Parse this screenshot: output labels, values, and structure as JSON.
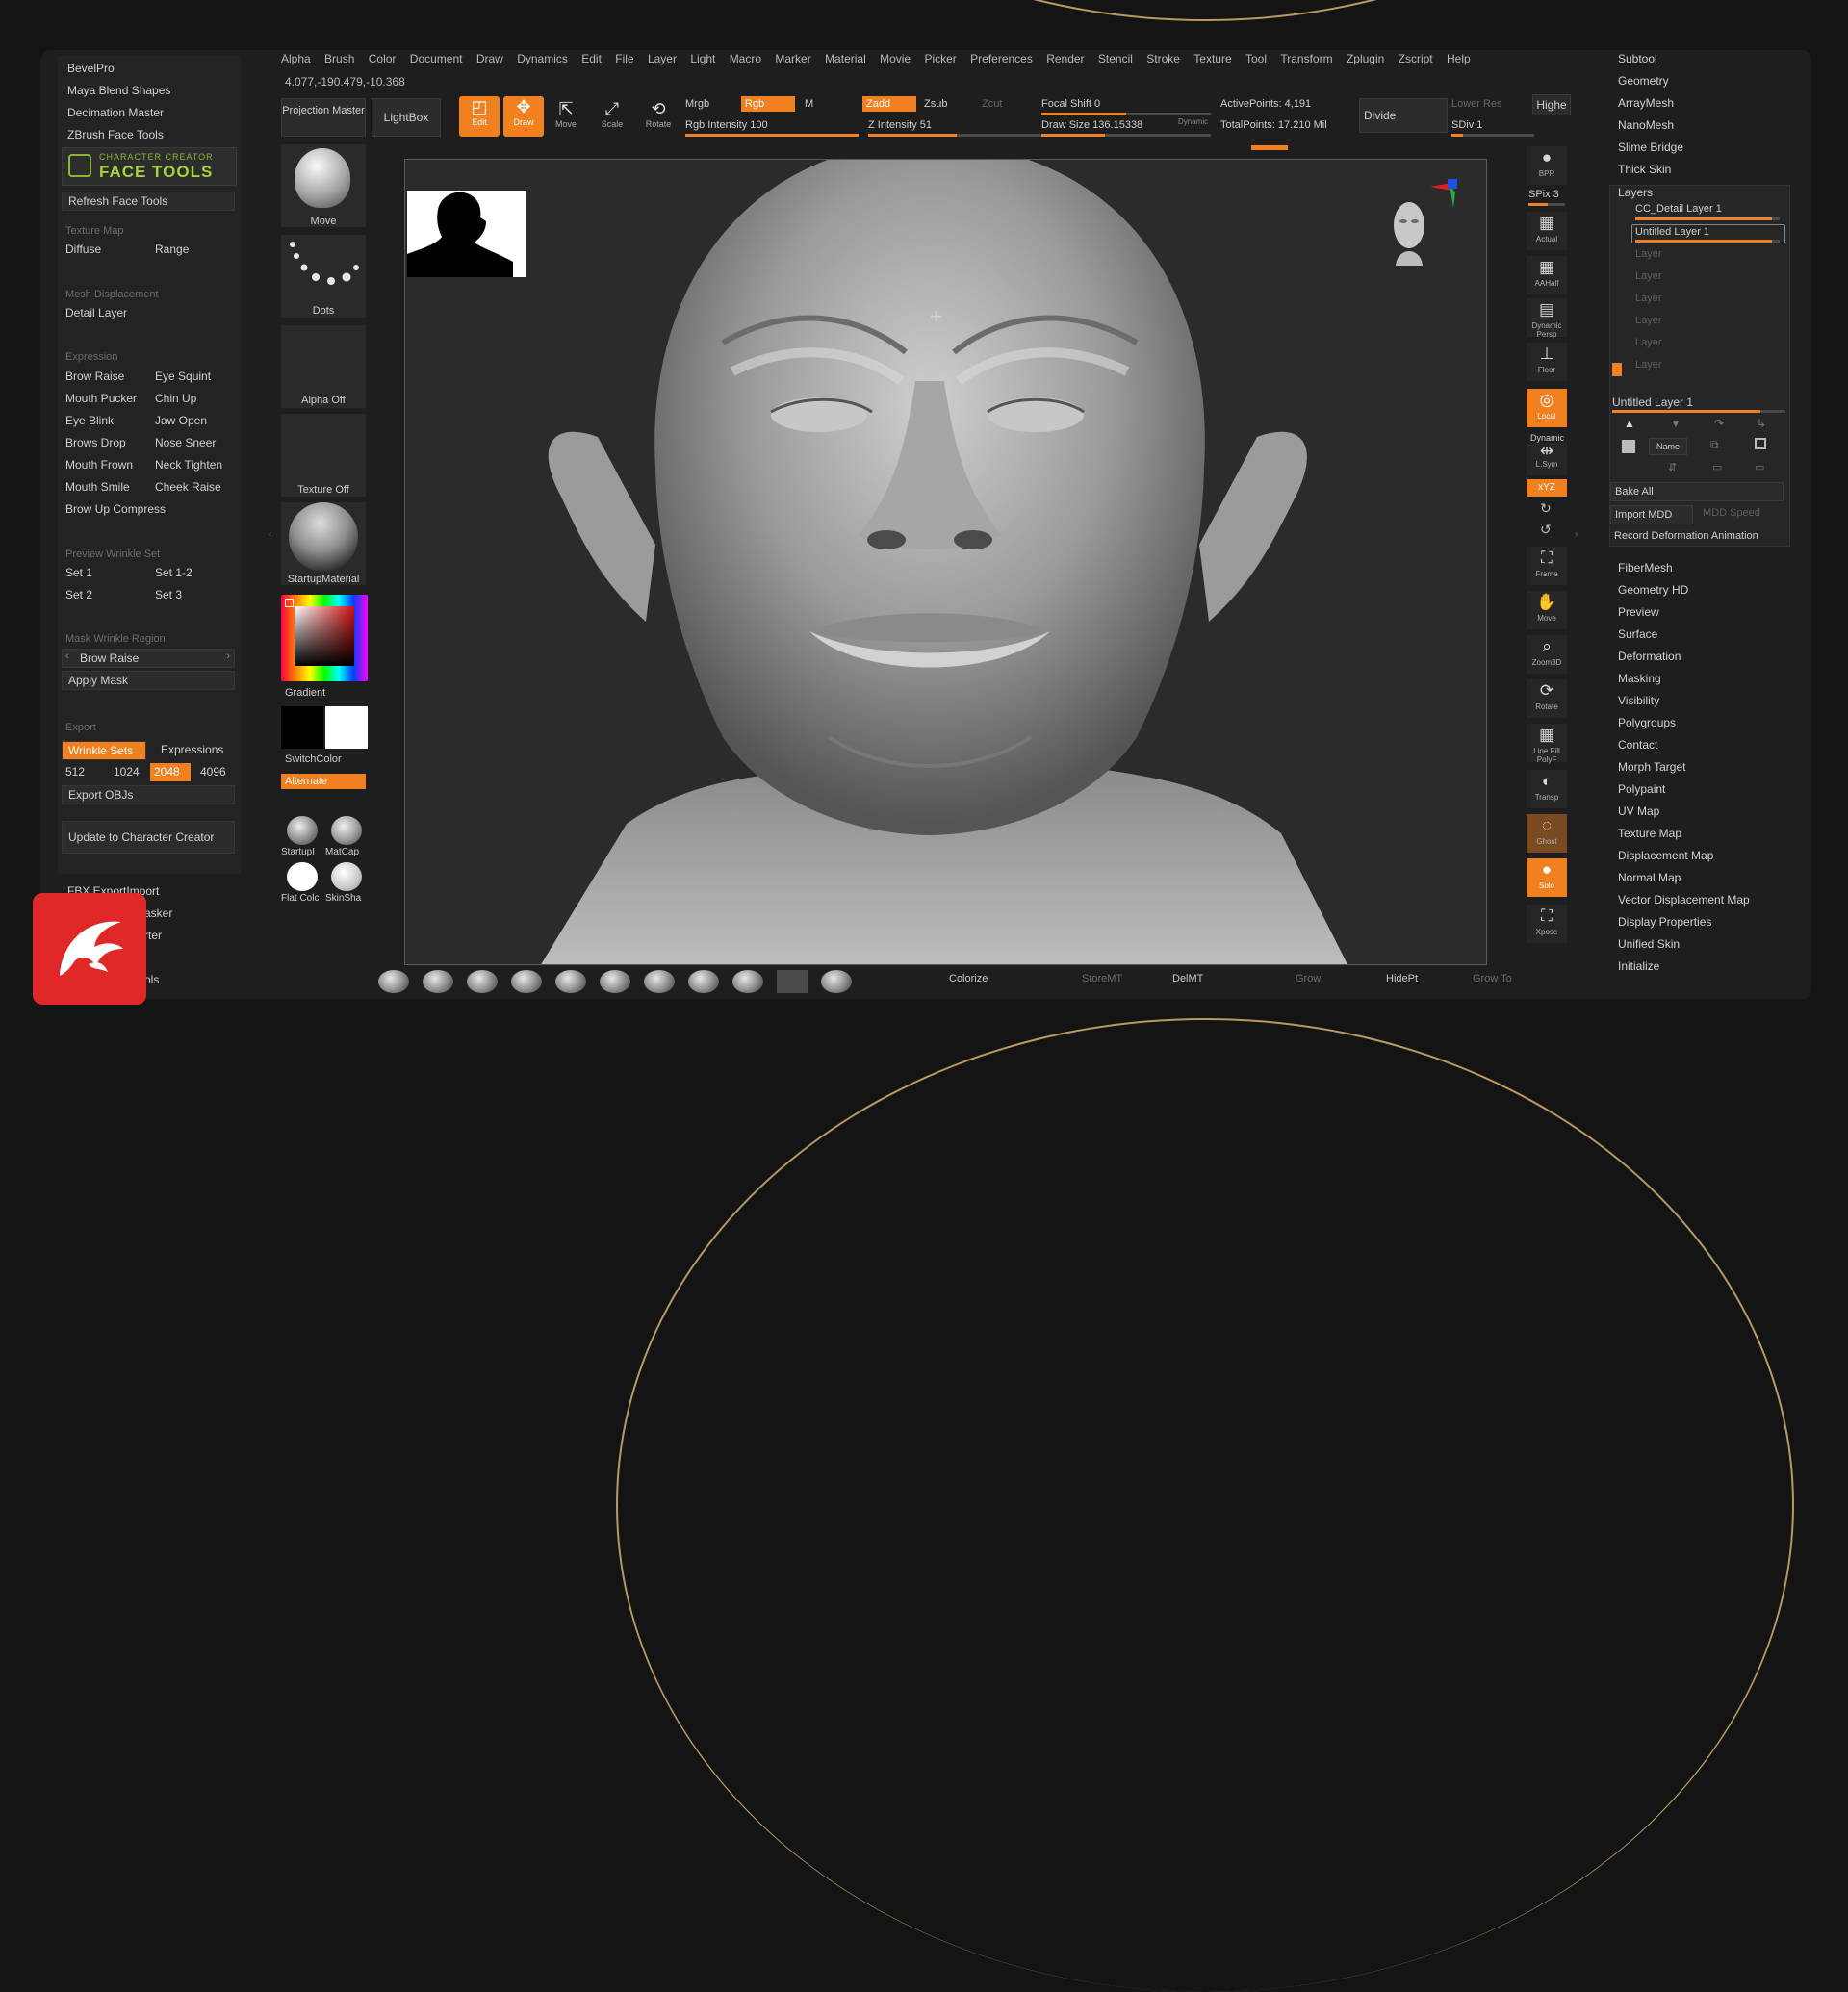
{
  "left_panel": {
    "plugins": [
      "BevelPro",
      "Maya Blend Shapes",
      "Decimation Master",
      "ZBrush Face Tools"
    ],
    "logo_line1": "CHARACTER CREATOR",
    "logo_line2": "FACE TOOLS",
    "refresh": "Refresh Face Tools",
    "texture_map_head": "Texture Map",
    "diffuse": "Diffuse",
    "range": "Range",
    "mesh_disp_head": "Mesh Displacement",
    "detail_layer": "Detail Layer",
    "expression_head": "Expression",
    "expressions": [
      [
        "Brow Raise",
        "Eye Squint"
      ],
      [
        "Mouth Pucker",
        "Chin Up"
      ],
      [
        "Eye Blink",
        "Jaw Open"
      ],
      [
        "Brows Drop",
        "Nose Sneer"
      ],
      [
        "Mouth Frown",
        "Neck Tighten"
      ],
      [
        "Mouth Smile",
        "Cheek Raise"
      ]
    ],
    "brow_up_compress": "Brow Up Compress",
    "preview_head": "Preview Wrinkle Set",
    "sets": [
      [
        "Set 1",
        "Set 1-2"
      ],
      [
        "Set 2",
        "Set 3"
      ]
    ],
    "mask_head": "Mask Wrinkle Region",
    "mask_select": "Brow Raise",
    "apply_mask": "Apply Mask",
    "export_head": "Export",
    "wrinkle_sets": "Wrinkle Sets",
    "expressions_btn": "Expressions",
    "sizes": [
      "512",
      "1024",
      "2048",
      "4096"
    ],
    "export_objs": "Export OBJs",
    "update_cc": "Update to Character Creator",
    "fbx": "FBX ExportImport",
    "partial": [
      "asker",
      "rter",
      "ols"
    ]
  },
  "menu": [
    "Alpha",
    "Brush",
    "Color",
    "Document",
    "Draw",
    "Dynamics",
    "Edit",
    "File",
    "Layer",
    "Light",
    "Macro",
    "Marker",
    "Material",
    "Movie",
    "Picker",
    "Preferences",
    "Render",
    "Stencil",
    "Stroke",
    "Texture",
    "Tool",
    "Transform",
    "Zplugin",
    "Zscript",
    "Help"
  ],
  "coords": "4.077,-190.479,-10.368",
  "toolbar": {
    "projection_master": "Projection Master",
    "lightbox": "LightBox",
    "edit": "Edit",
    "draw": "Draw",
    "move": "Move",
    "scale": "Scale",
    "rotate": "Rotate",
    "mrgb": "Mrgb",
    "rgb": "Rgb",
    "m": "M",
    "rgb_intensity": "Rgb Intensity 100",
    "zadd": "Zadd",
    "zsub": "Zsub",
    "zcut": "Zcut",
    "z_intensity": "Z Intensity 51",
    "focal_shift": "Focal Shift 0",
    "draw_size": "Draw Size 136.15338",
    "dynamic": "Dynamic",
    "active_points": "ActivePoints: 4,191",
    "total_points": "TotalPoints: 17.210 Mil",
    "divide": "Divide",
    "lower_res": "Lower Res",
    "higher_res": "Highe",
    "sdiv": "SDiv 1"
  },
  "brush_column": {
    "move": "Move",
    "dots": "Dots",
    "alpha_off": "Alpha Off",
    "texture_off": "Texture Off",
    "startup_material": "StartupMaterial",
    "gradient": "Gradient",
    "switch_color": "SwitchColor",
    "alternate": "Alternate",
    "mat1": "StartupI",
    "mat2": "MatCap",
    "mat3": "Flat Colc",
    "mat4": "SkinSha"
  },
  "right_shelf": {
    "bpr": "BPR",
    "spix": "SPix 3",
    "actual": "Actual",
    "aahalf": "AAHalf",
    "dynamic_persp": "Dynamic Persp",
    "floor": "Floor",
    "local": "Local",
    "dynamic": "Dynamic",
    "lsym": "L.Sym",
    "xyz": "xYZ",
    "frame": "Frame",
    "move": "Move",
    "zoom3d": "Zoom3D",
    "rotate": "Rotate",
    "linefill": "Line Fill PolyF",
    "transp": "Transp",
    "ghost": "Ghost",
    "solo": "Solo",
    "xpose": "Xpose"
  },
  "right_panel": {
    "top_items": [
      "Subtool",
      "Geometry",
      "ArrayMesh",
      "NanoMesh",
      "Slime Bridge",
      "Thick Skin"
    ],
    "layers": "Layers",
    "layer_list": [
      "CC_Detail Layer 1",
      "Untitled Layer 1",
      "Layer",
      "Layer",
      "Layer",
      "Layer",
      "Layer",
      "Layer"
    ],
    "current_layer": "Untitled Layer 1",
    "name_btn": "Name",
    "bake_all": "Bake All",
    "import_mdd": "Import MDD",
    "mdd_speed": "MDD Speed",
    "record": "Record Deformation Animation",
    "bottom_items": [
      "FiberMesh",
      "Geometry HD",
      "Preview",
      "Surface",
      "Deformation",
      "Masking",
      "Visibility",
      "Polygroups",
      "Contact",
      "Morph Target",
      "Polypaint",
      "UV Map",
      "Texture Map",
      "Displacement Map",
      "Normal Map",
      "Vector Displacement Map",
      "Display Properties",
      "Unified Skin",
      "Initialize"
    ]
  },
  "bottom_bar": {
    "colorize": "Colorize",
    "storemt": "StoreMT",
    "delmt": "DelMT",
    "grow": "Grow",
    "hidept": "HidePt",
    "growto": "Grow To"
  },
  "colors": {
    "accent": "#f08020",
    "background": "#1e1e1e",
    "panel": "#232323",
    "frame_gold": "#b79a62",
    "app_logo": "#e02828"
  }
}
